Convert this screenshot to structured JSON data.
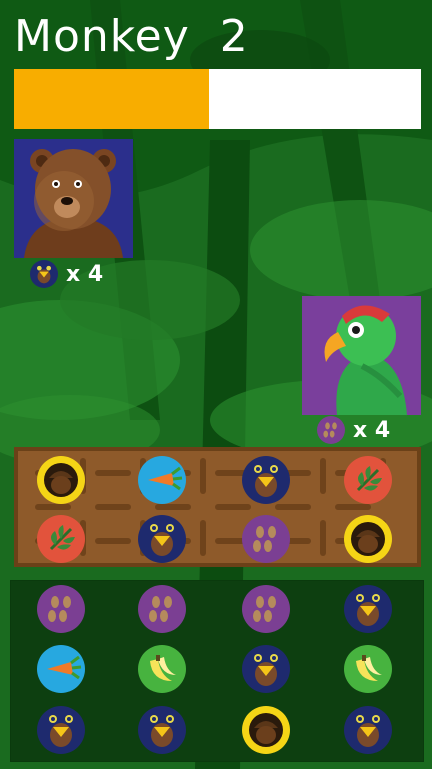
{
  "title": "Monkey  2",
  "progress": {
    "fraction": 0.48,
    "fill_color": "#f8ad00",
    "track_color": "#ffffff"
  },
  "customers": [
    {
      "animal": "bear-icon",
      "wants": "moth-icon",
      "count_text": "x 4"
    },
    {
      "animal": "parrot-icon",
      "wants": "seeds-icon",
      "count_text": "x 4"
    }
  ],
  "crate_rows": [
    [
      "acorn-icon",
      "carrot-icon",
      "moth-icon",
      "leaf-icon"
    ],
    [
      "leaf-icon",
      "moth-icon",
      "seeds-icon",
      "acorn-icon"
    ]
  ],
  "grid_rows": [
    [
      "seeds-icon",
      "seeds-icon",
      "seeds-icon",
      "moth-icon"
    ],
    [
      "carrot-icon",
      "banana-icon",
      "moth-icon",
      "banana-icon"
    ],
    [
      "moth-icon",
      "moth-icon",
      "acorn-icon",
      "moth-icon"
    ]
  ],
  "colors": {
    "acorn-icon": "#f5d516",
    "carrot-icon": "#27a8e0",
    "moth-icon": "#1e2a6e",
    "leaf-icon": "#e2533c",
    "seeds-icon": "#7b3f93",
    "banana-icon": "#47b33f"
  }
}
